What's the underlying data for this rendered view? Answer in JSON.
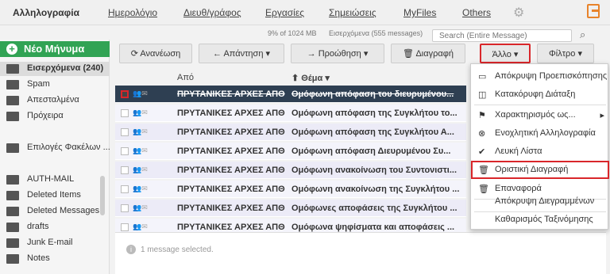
{
  "nav": {
    "items": [
      "Αλληλογραφία",
      "Ημερολόγιο",
      "Διευθ/γράφος",
      "Εργασίες",
      "Σημειώσεις",
      "MyFiles",
      "Others"
    ]
  },
  "status": {
    "quota": "9% of 1024 MB",
    "inbox": "Εισερχόμενα (555 messages)"
  },
  "search": {
    "placeholder": "Search (Entire Message)"
  },
  "sidebar": {
    "new_message": "Νέο Μήνυμα",
    "folders": [
      "Εισερχόμενα (240)",
      "Spam",
      "Απεσταλμένα",
      "Πρόχειρα",
      "Επιλογές Φακέλων ..."
    ],
    "account": "AUTH-MAIL",
    "account_folders": [
      "Deleted Items",
      "Deleted Messages",
      "drafts",
      "Junk E-mail",
      "Notes"
    ]
  },
  "toolbar": {
    "refresh": "Ανανέωση",
    "reply": "Απάντηση",
    "forward": "Προώθηση",
    "delete": "Διαγραφή",
    "more": "Άλλο",
    "filter": "Φίλτρο"
  },
  "list": {
    "col_from": "Από",
    "col_subject": "Θέμα",
    "rows": [
      {
        "from": "ΠΡΥΤΑΝΙΚΕΣ ΑΡΧΕΣ ΑΠΘ",
        "subject": "Ομόφωνη απόφαση του διευρυμένου..."
      },
      {
        "from": "ΠΡΥΤΑΝΙΚΕΣ ΑΡΧΕΣ ΑΠΘ",
        "subject": "Ομόφωνη απόφαση της Συγκλήτου το..."
      },
      {
        "from": "ΠΡΥΤΑΝΙΚΕΣ ΑΡΧΕΣ ΑΠΘ",
        "subject": "Ομόφωνη απόφαση της Συγκλήτου Α..."
      },
      {
        "from": "ΠΡΥΤΑΝΙΚΕΣ ΑΡΧΕΣ ΑΠΘ",
        "subject": "Ομόφωνη απόφαση Διευρυμένου Συ..."
      },
      {
        "from": "ΠΡΥΤΑΝΙΚΕΣ ΑΡΧΕΣ ΑΠΘ",
        "subject": "Ομόφωνη ανακοίνωση του Συντονιστι..."
      },
      {
        "from": "ΠΡΥΤΑΝΙΚΕΣ ΑΡΧΕΣ ΑΠΘ",
        "subject": "Ομόφωνη ανακοίνωση της Συγκλήτου ..."
      },
      {
        "from": "ΠΡΥΤΑΝΙΚΕΣ ΑΡΧΕΣ ΑΠΘ",
        "subject": "Ομόφωνες αποφάσεις της Συγκλήτου ..."
      },
      {
        "from": "ΠΡΥΤΑΝΙΚΕΣ ΑΡΧΕΣ ΑΠΘ",
        "subject": "Ομόφωνα ψηφίσματα και αποφάσεις ..."
      }
    ]
  },
  "preview": {
    "info": "1 message selected."
  },
  "menu": {
    "items": [
      "Απόκρυψη Προεπισκόπησης",
      "Κατακόρυφη Διάταξη",
      "Χαρακτηρισμός ως...",
      "Ενοχλητική Αλληλογραφία",
      "Λευκή Λίστα",
      "Οριστική Διαγραφή",
      "Επαναφορά",
      "Απόκρυψη Διεγραμμένων",
      "Καθαρισμός Ταξινόμησης"
    ]
  },
  "colors": {
    "accent_green": "#31a354",
    "highlight_red": "#d9262a",
    "selected_row": "#2e3f52"
  }
}
